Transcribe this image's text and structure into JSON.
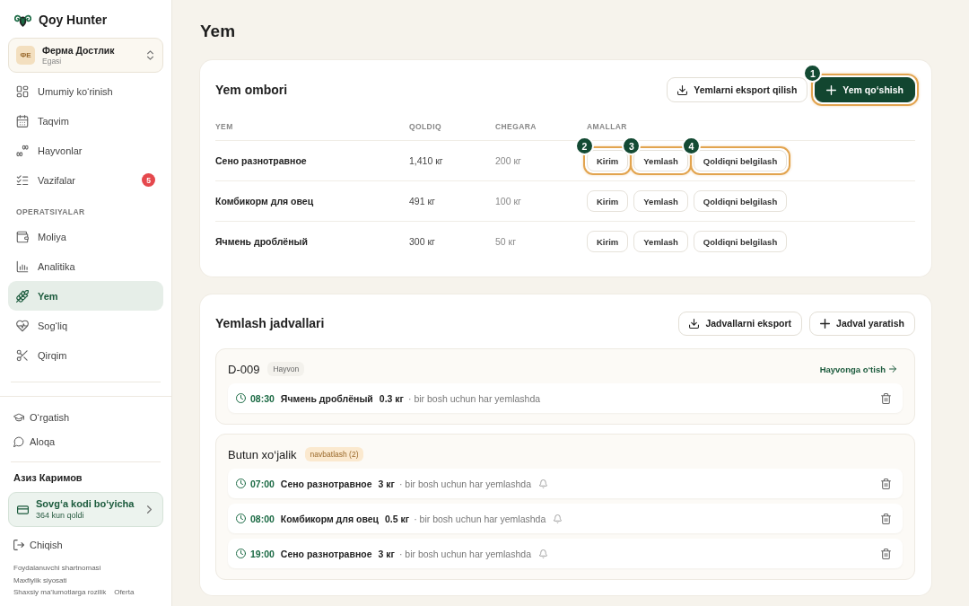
{
  "sidebar": {
    "brand": "Qoy Hunter",
    "farm": {
      "initials": "ФЕ",
      "name": "Ферма Достлик",
      "role": "Egasi"
    },
    "sections": [
      {
        "items": [
          {
            "label": "Umumiy ko‘rinish",
            "selected": false
          },
          {
            "label": "Taqvim",
            "selected": false
          },
          {
            "label": "Hayvonlar",
            "selected": false
          },
          {
            "label": "Vazifalar",
            "selected": false,
            "badge": "5"
          }
        ]
      },
      {
        "heading": "OPERATSIYALAR",
        "items": [
          {
            "label": "Moliya",
            "selected": false
          },
          {
            "label": "Analitika",
            "selected": false
          },
          {
            "label": "Yem",
            "selected": true
          },
          {
            "label": "Sog‘liq",
            "selected": false
          },
          {
            "label": "Qirqim",
            "selected": false
          }
        ]
      }
    ],
    "secondary_items": [
      {
        "label": "O‘rgatish",
        "selected": false
      },
      {
        "label": "Aloqa",
        "selected": false
      }
    ],
    "user_name": "Азиз Каримов",
    "subscription": {
      "title": "Sovg‘a kodi bo‘yicha",
      "subtitle": "364 kun qoldi"
    },
    "logout": "Chiqish",
    "legal_links": [
      [
        "Foydalanuvchi shartnomasi"
      ],
      [
        "Maxfiylik siyosati"
      ],
      [
        "Shaxsiy ma’lumotlarga rozilik",
        "Oferta"
      ]
    ]
  },
  "page_title": "Yem",
  "stock": {
    "title": "Yem ombori",
    "buttons": [
      {
        "label": "Yemlarni eksport qilish",
        "kind": "export"
      },
      {
        "label": "Yem qo‘shish",
        "kind": "primary",
        "tour_step": "1"
      }
    ],
    "columns": [
      "YEM",
      "QOLDIQ",
      "CHEGARA",
      "AMALLAR"
    ],
    "rows": [
      {
        "feed": "Сено разнотравное",
        "remaining": "1,410 кг",
        "limit": "200 кг",
        "actions": [
          {
            "label": "Kirim",
            "tour_step": "2"
          },
          {
            "label": "Yemlash",
            "tour_step": "3"
          },
          {
            "label": "Qoldiqni belgilash",
            "tour_step": "4"
          }
        ]
      },
      {
        "feed": "Комбикорм для овец",
        "remaining": "491 кг",
        "limit": "100 кг",
        "actions": [
          {
            "label": "Kirim"
          },
          {
            "label": "Yemlash"
          },
          {
            "label": "Qoldiqni belgilash"
          }
        ]
      },
      {
        "feed": "Ячмень дроблёный",
        "remaining": "300 кг",
        "limit": "50 кг",
        "actions": [
          {
            "label": "Kirim"
          },
          {
            "label": "Yemlash"
          },
          {
            "label": "Qoldiqni belgilash"
          }
        ]
      }
    ]
  },
  "schedules": {
    "title": "Yemlash jadvallari",
    "buttons": [
      {
        "label": "Jadvallarni eksport",
        "kind": "export"
      },
      {
        "label": "Jadval yaratish",
        "kind": "create"
      }
    ],
    "groups": [
      {
        "title": "D-009",
        "tag": {
          "label": "Hayvon",
          "kind": "neutral"
        },
        "link": "Hayvonga o‘tish",
        "entries": [
          {
            "time": "08:30",
            "feed": "Ячмень дроблёный",
            "amount": "0.3 кг",
            "note": "· bir bosh uchun har yemlashda",
            "reminder": false
          }
        ]
      },
      {
        "title": "Butun xo‘jalik",
        "tag": {
          "label": "navbatlash (2)",
          "kind": "warning"
        },
        "entries": [
          {
            "time": "07:00",
            "feed": "Сено разнотравное",
            "amount": "3 кг",
            "note": "· bir bosh uchun har yemlashda",
            "reminder": true
          },
          {
            "time": "08:00",
            "feed": "Комбикорм для овец",
            "amount": "0.5 кг",
            "note": "· bir bosh uchun har yemlashda",
            "reminder": true
          },
          {
            "time": "19:00",
            "feed": "Сено разнотравное",
            "amount": "3 кг",
            "note": "· bir bosh uchun har yemlashda",
            "reminder": true
          }
        ]
      }
    ]
  }
}
